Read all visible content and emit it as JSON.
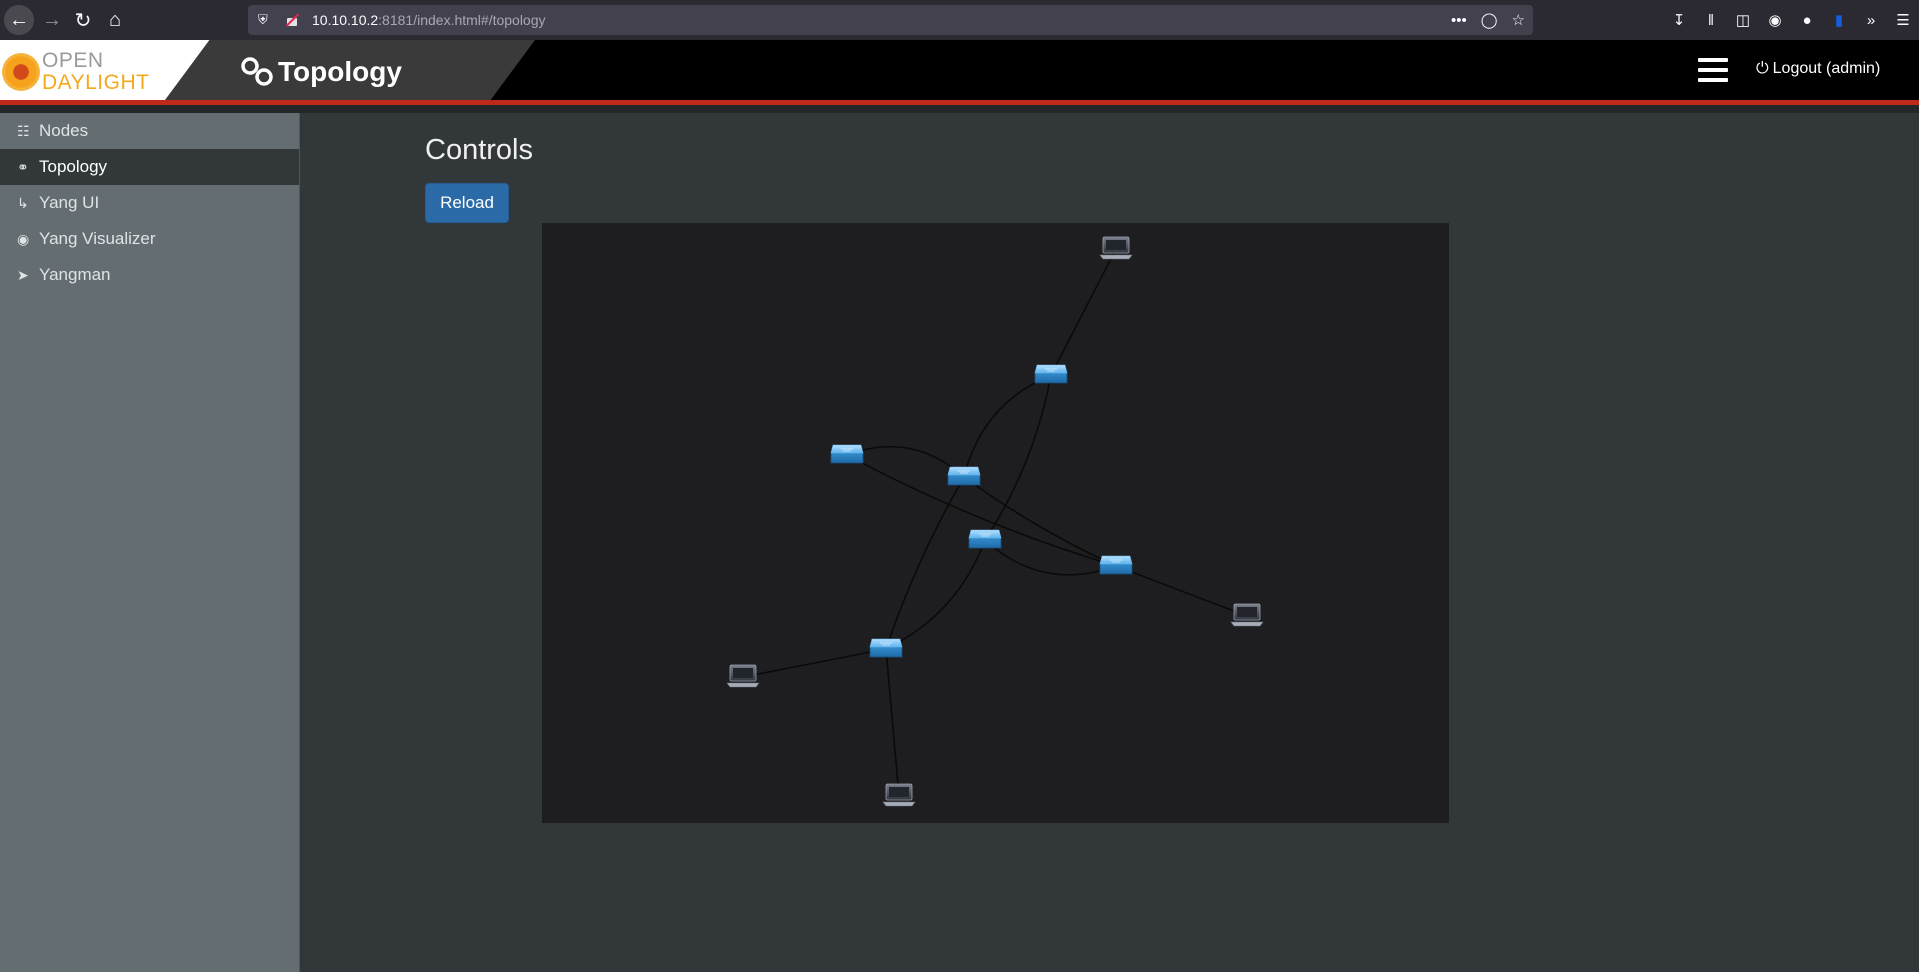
{
  "browser": {
    "url_host": "10.10.10.2",
    "url_rest": ":8181/index.html#/topology",
    "more_actions": "•••"
  },
  "header": {
    "logo_open": "OPEN",
    "logo_daylight": "DAYLIGHT",
    "title": "Topology",
    "logout_label": "Logout (admin)"
  },
  "sidebar": {
    "items": [
      {
        "label": "Nodes",
        "icon": "sitemap-icon",
        "active": false
      },
      {
        "label": "Topology",
        "icon": "link-icon",
        "active": true
      },
      {
        "label": "Yang UI",
        "icon": "arrow-down-icon",
        "active": false
      },
      {
        "label": "Yang Visualizer",
        "icon": "eye-icon",
        "active": false
      },
      {
        "label": "Yangman",
        "icon": "rocket-icon",
        "active": false
      }
    ]
  },
  "main": {
    "controls_title": "Controls",
    "reload_label": "Reload"
  },
  "colors": {
    "accent_red": "#c0281c",
    "button_blue": "#2a6aa6",
    "switch_blue": "#3a9ad9",
    "canvas_bg": "#1e1e20"
  },
  "topology": {
    "nodes": [
      {
        "id": "host-1",
        "type": "host"
      },
      {
        "id": "switch-1",
        "type": "switch"
      },
      {
        "id": "switch-2",
        "type": "switch"
      },
      {
        "id": "switch-3",
        "type": "switch"
      },
      {
        "id": "switch-4",
        "type": "switch"
      },
      {
        "id": "switch-5",
        "type": "switch"
      },
      {
        "id": "switch-6",
        "type": "switch"
      },
      {
        "id": "host-2",
        "type": "host"
      },
      {
        "id": "host-3",
        "type": "host"
      },
      {
        "id": "host-4",
        "type": "host"
      }
    ],
    "links": [
      [
        "host-1",
        "switch-1"
      ],
      [
        "switch-1",
        "switch-3"
      ],
      [
        "switch-1",
        "switch-4"
      ],
      [
        "switch-2",
        "switch-3"
      ],
      [
        "switch-2",
        "switch-5"
      ],
      [
        "switch-3",
        "switch-6"
      ],
      [
        "switch-3",
        "switch-5"
      ],
      [
        "switch-4",
        "switch-5"
      ],
      [
        "switch-4",
        "switch-6"
      ],
      [
        "switch-5",
        "host-2"
      ],
      [
        "switch-6",
        "host-3"
      ],
      [
        "switch-6",
        "host-4"
      ]
    ]
  }
}
